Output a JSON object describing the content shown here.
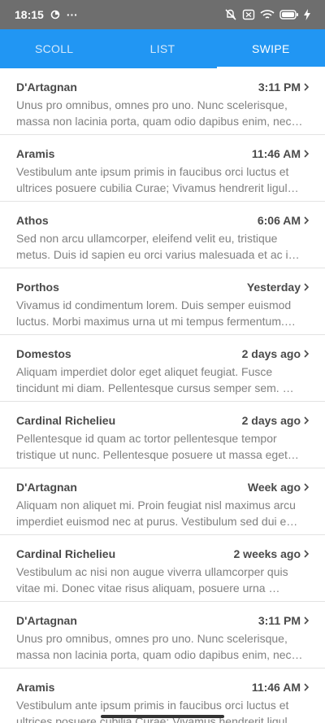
{
  "status_bar": {
    "time": "18:15",
    "dots": "···",
    "icons": [
      "data-saver-icon",
      "mute-icon",
      "sim-off-icon",
      "wifi-icon",
      "battery-icon",
      "charging-icon"
    ]
  },
  "tabs": [
    {
      "label": "SCOLL",
      "active": false
    },
    {
      "label": "LIST",
      "active": false
    },
    {
      "label": "SWIPE",
      "active": true
    }
  ],
  "colors": {
    "primary": "#2196f3",
    "status_bar": "#6e6e6e"
  },
  "items": [
    {
      "name": "D'Artagnan",
      "time": "3:11 PM",
      "text": "Unus pro omnibus, omnes pro uno. Nunc scelerisque, massa non lacinia porta, quam odio dapibus enim, nec…"
    },
    {
      "name": "Aramis",
      "time": "11:46 AM",
      "text": "Vestibulum ante ipsum primis in faucibus orci luctus et ultrices posuere cubilia Curae; Vivamus hendrerit ligul…"
    },
    {
      "name": "Athos",
      "time": "6:06 AM",
      "text": "Sed non arcu ullamcorper, eleifend velit eu, tristique metus. Duis id sapien eu orci varius malesuada et ac i…"
    },
    {
      "name": "Porthos",
      "time": "Yesterday",
      "text": "Vivamus id condimentum lorem. Duis semper euismod luctus. Morbi maximus urna ut mi tempus fermentum.…"
    },
    {
      "name": "Domestos",
      "time": "2 days ago",
      "text": "Aliquam imperdiet dolor eget aliquet feugiat. Fusce tincidunt mi diam. Pellentesque cursus semper sem. …"
    },
    {
      "name": "Cardinal Richelieu",
      "time": "2 days ago",
      "text": "Pellentesque id quam ac tortor pellentesque tempor tristique ut nunc. Pellentesque posuere ut massa eget…"
    },
    {
      "name": "D'Artagnan",
      "time": "Week ago",
      "text": "Aliquam non aliquet mi. Proin feugiat nisl maximus arcu imperdiet euismod nec at purus. Vestibulum sed dui e…"
    },
    {
      "name": "Cardinal Richelieu",
      "time": "2 weeks ago",
      "text": "Vestibulum ac nisi non augue viverra ullamcorper quis vitae mi. Donec vitae risus aliquam, posuere urna …"
    },
    {
      "name": "D'Artagnan",
      "time": "3:11 PM",
      "text": "Unus pro omnibus, omnes pro uno. Nunc scelerisque, massa non lacinia porta, quam odio dapibus enim, nec…"
    },
    {
      "name": "Aramis",
      "time": "11:46 AM",
      "text": "Vestibulum ante ipsum primis in faucibus orci luctus et ultrices posuere cubilia Curae; Vivamus hendrerit ligul…"
    }
  ]
}
